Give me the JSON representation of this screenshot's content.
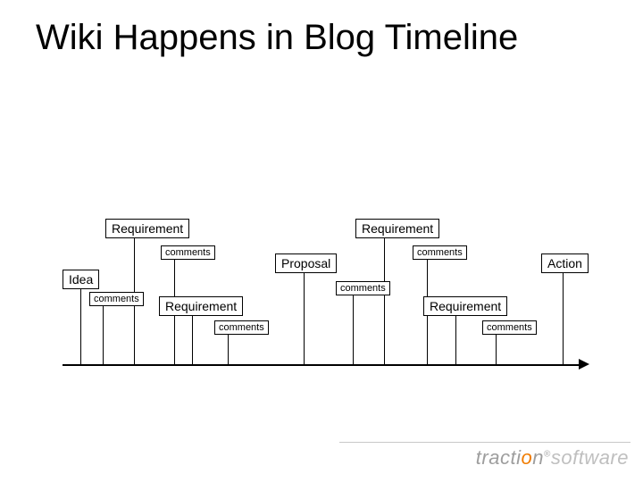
{
  "title": "Wiki Happens in Blog Timeline",
  "boxes": {
    "req_top_left": "Requirement",
    "req_top_right": "Requirement",
    "comments_under_req_left": "comments",
    "comments_under_req_right": "comments",
    "idea": "Idea",
    "idea_comments": "comments",
    "proposal": "Proposal",
    "proposal_comments": "comments",
    "action": "Action",
    "req_mid_left": "Requirement",
    "req_mid_left_comments": "comments",
    "req_mid_right": "Requirement",
    "req_mid_right_comments": "comments"
  },
  "logo": {
    "brand_a": "tracti",
    "brand_dot": "o",
    "brand_n": "n",
    "reg": "®",
    "brand_b": "software"
  }
}
